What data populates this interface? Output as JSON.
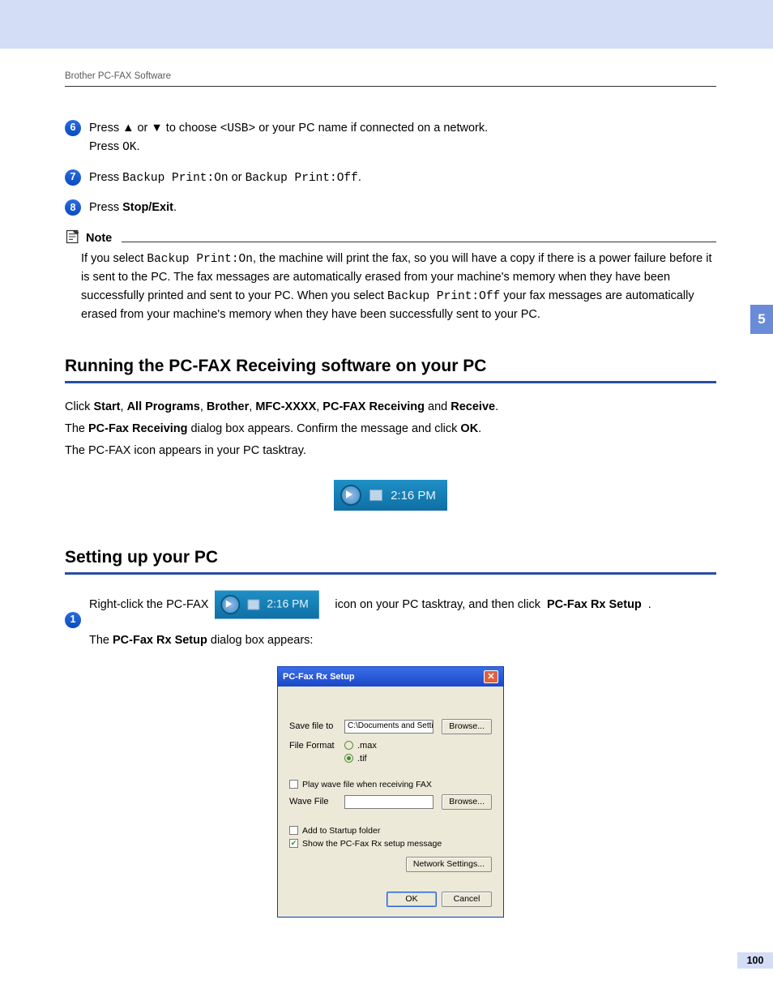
{
  "header": {
    "breadcrumb": "Brother PC-FAX Software"
  },
  "chapter_tab": "5",
  "page_number": "100",
  "steps_top": {
    "s6": {
      "num": "6",
      "prefix": "Press ",
      "arrow_up": "▲",
      "mid1": " or ",
      "arrow_down": "▼",
      "mid2": " to choose ",
      "usb": "<USB>",
      "tail": " or your PC name if connected on a network.",
      "line2a": "Press ",
      "ok": "OK",
      "line2b": "."
    },
    "s7": {
      "num": "7",
      "prefix": "Press ",
      "opt1": "Backup Print:On",
      "mid": " or ",
      "opt2": "Backup Print:Off",
      "tail": "."
    },
    "s8": {
      "num": "8",
      "prefix": "Press ",
      "stopexit": "Stop/Exit",
      "tail": "."
    }
  },
  "note": {
    "label": "Note",
    "body_a": "If you select ",
    "on": "Backup Print:On",
    "body_b": ", the machine will print the fax, so you will have a copy if there is a power failure before it is sent to the PC. The fax messages are automatically erased from your machine's memory when they have been successfully printed and sent to your PC. When you select ",
    "off": "Backup Print:Off",
    "body_c": " your fax messages are automatically erased from your machine's memory when they have been successfully sent to your PC."
  },
  "sec1": {
    "heading": "Running the PC-FAX Receiving software on your PC",
    "p1_a": "Click ",
    "start": "Start",
    "c1": ", ",
    "allprog": "All Programs",
    "c2": ", ",
    "brother": "Brother",
    "c3": ", ",
    "mfc": "MFC-XXXX",
    "c4": ", ",
    "pcfaxrecv": "PC-FAX Receiving",
    "and": " and ",
    "receive": "Receive",
    "p1_end": ".",
    "p2_a": "The ",
    "p2_b": "PC-Fax Receiving",
    "p2_c": " dialog box appears. Confirm the message and click ",
    "p2_ok": "OK",
    "p2_end": ".",
    "p3": "The PC-FAX icon appears in your PC tasktray.",
    "tray_time": "2:16 PM"
  },
  "sec2": {
    "heading": "Setting up your PC",
    "step1": {
      "num": "1",
      "pre": "Right-click the PC-FAX ",
      "tray_time": "2:16 PM",
      "mid": " icon on your PC tasktray, and then click ",
      "menu": "PC-Fax Rx Setup",
      "tail": ".",
      "line2a": "The ",
      "line2b": "PC-Fax Rx Setup",
      "line2c": " dialog box appears:"
    }
  },
  "dialog": {
    "title": "PC-Fax Rx Setup",
    "save_label": "Save file to",
    "save_path": "C:\\Documents and Settings\\All Use",
    "browse": "Browse...",
    "format_label": "File Format",
    "fmt_max": ".max",
    "fmt_tif": ".tif",
    "play_wave": "Play wave file when receiving FAX",
    "wave_label": "Wave File",
    "add_startup": "Add to Startup folder",
    "show_setup": "Show the PC-Fax Rx setup message",
    "net_settings": "Network Settings...",
    "ok": "OK",
    "cancel": "Cancel"
  }
}
